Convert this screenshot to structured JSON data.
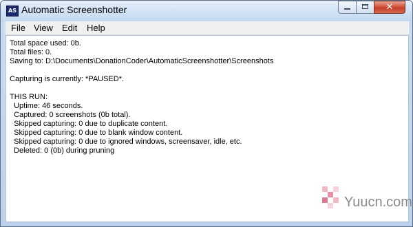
{
  "window": {
    "title": "Automatic Screenshotter",
    "icon_label": "AS",
    "controls": {
      "minimize": "minimize",
      "maximize": "maximize",
      "close": "✕"
    }
  },
  "menu": [
    "File",
    "View",
    "Edit",
    "Help"
  ],
  "status": {
    "total_space": "Total space used: 0b.",
    "total_files": "Total files: 0.",
    "saving_to": "Saving to: D:\\Documents\\DonationCoder\\AutomaticScreenshotter\\Screenshots",
    "capturing": "Capturing is currently: *PAUSED*.",
    "run_header": "THIS RUN:",
    "run_lines": [
      "  Uptime: 46 seconds.",
      "  Captured: 0 screenshots (0b total).",
      "  Skipped capturing: 0 due to duplicate content.",
      "  Skipped capturing: 0 due to blank window content.",
      "  Skipped capturing: 0 due to ignored windows, screensaver, idle, etc.",
      "  Deleted: 0 (0b) during pruning"
    ]
  },
  "watermark": {
    "text": "Yuucn.com",
    "colors": [
      "#f2b8c6",
      "#e88fa5",
      "#f7d3dc",
      "#d97a94"
    ]
  }
}
